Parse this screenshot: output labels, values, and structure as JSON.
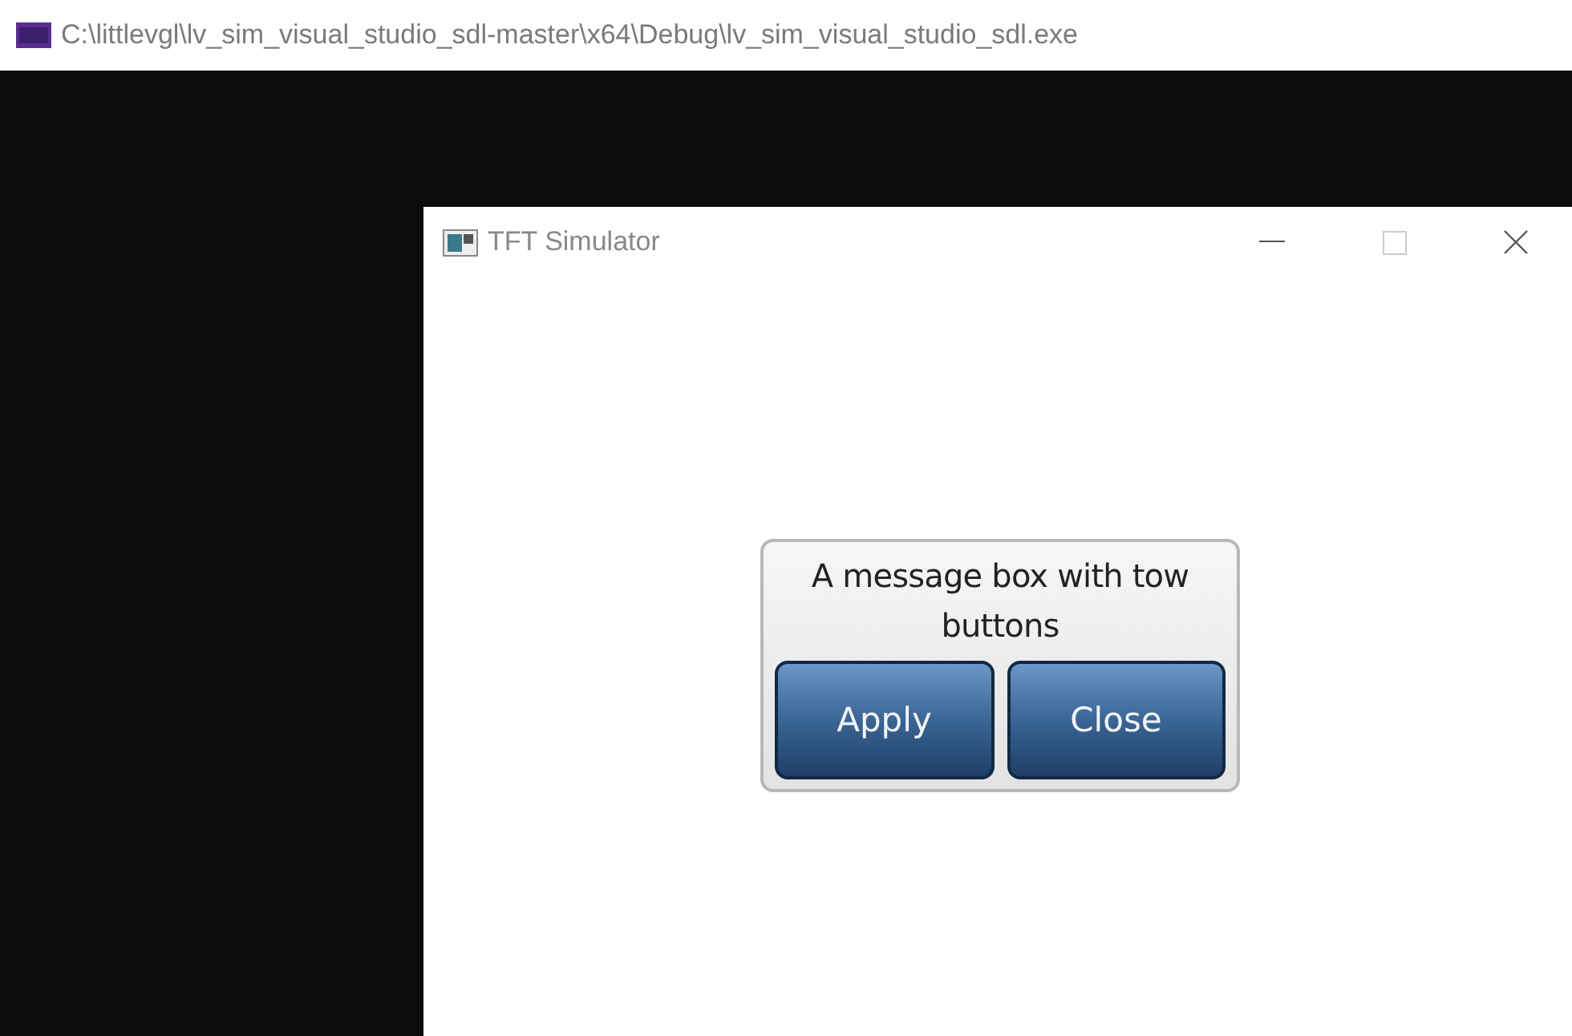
{
  "console_window": {
    "title": "C:\\littlevgl\\lv_sim_visual_studio_sdl-master\\x64\\Debug\\lv_sim_visual_studio_sdl.exe"
  },
  "simulator_window": {
    "title": "TFT Simulator"
  },
  "message_box": {
    "text": "A message box with tow buttons",
    "buttons": [
      {
        "label": "Apply"
      },
      {
        "label": "Close"
      }
    ]
  }
}
